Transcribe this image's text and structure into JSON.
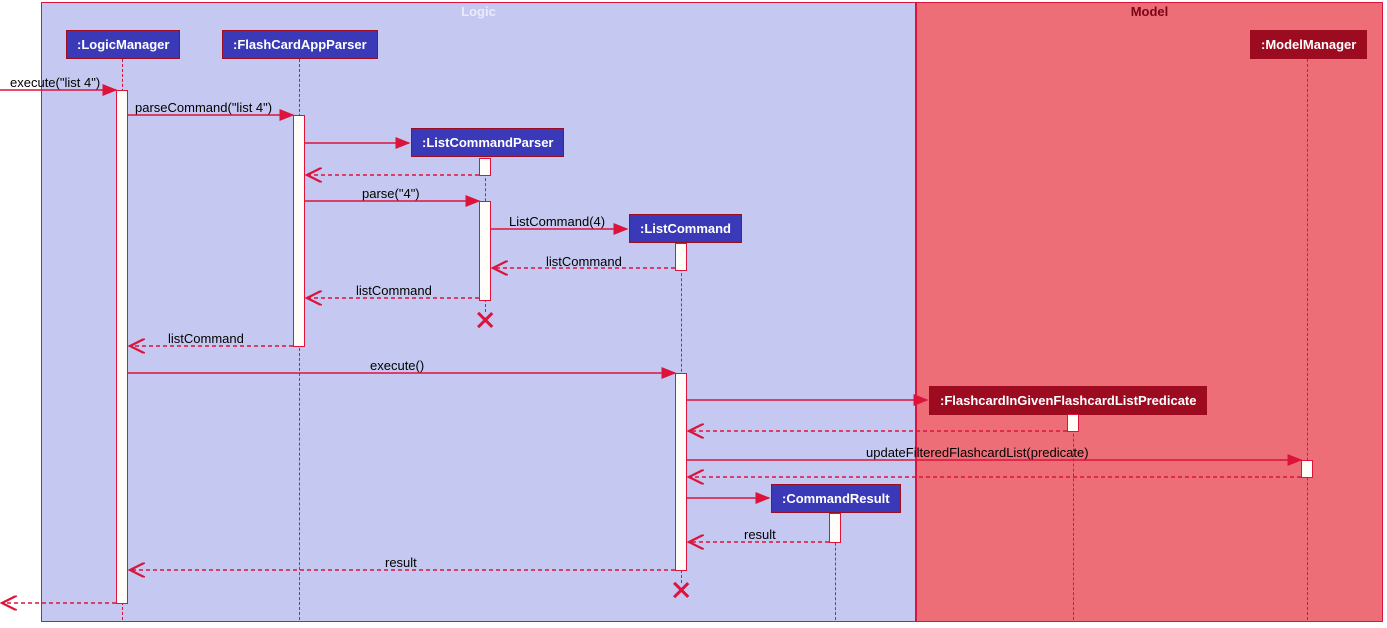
{
  "chart_data": {
    "type": "sequence-diagram",
    "frames": [
      {
        "name": "Logic",
        "participants": [
          ":LogicManager",
          ":FlashCardAppParser",
          ":ListCommandParser",
          ":ListCommand",
          ":CommandResult"
        ]
      },
      {
        "name": "Model",
        "participants": [
          ":ModelManager",
          ":FlashcardInGivenFlashcardListPredicate"
        ]
      }
    ],
    "messages": [
      {
        "from": "caller",
        "to": ":LogicManager",
        "label": "execute(\"list 4\")",
        "type": "sync"
      },
      {
        "from": ":LogicManager",
        "to": ":FlashCardAppParser",
        "label": "parseCommand(\"list 4\")",
        "type": "sync"
      },
      {
        "from": ":FlashCardAppParser",
        "to": ":ListCommandParser",
        "label": "",
        "type": "create"
      },
      {
        "from": ":ListCommandParser",
        "to": ":FlashCardAppParser",
        "label": "",
        "type": "return"
      },
      {
        "from": ":FlashCardAppParser",
        "to": ":ListCommandParser",
        "label": "parse(\"4\")",
        "type": "sync"
      },
      {
        "from": ":ListCommandParser",
        "to": ":ListCommand",
        "label": "ListCommand(4)",
        "type": "create"
      },
      {
        "from": ":ListCommand",
        "to": ":ListCommandParser",
        "label": "listCommand",
        "type": "return"
      },
      {
        "from": ":ListCommandParser",
        "to": ":FlashCardAppParser",
        "label": "listCommand",
        "type": "return"
      },
      {
        "from": ":ListCommandParser",
        "to": "destroy",
        "label": "",
        "type": "destroy"
      },
      {
        "from": ":FlashCardAppParser",
        "to": ":LogicManager",
        "label": "listCommand",
        "type": "return"
      },
      {
        "from": ":LogicManager",
        "to": ":ListCommand",
        "label": "execute()",
        "type": "sync"
      },
      {
        "from": ":ListCommand",
        "to": ":FlashcardInGivenFlashcardListPredicate",
        "label": "",
        "type": "create"
      },
      {
        "from": ":FlashcardInGivenFlashcardListPredicate",
        "to": ":ListCommand",
        "label": "",
        "type": "return"
      },
      {
        "from": ":ListCommand",
        "to": ":ModelManager",
        "label": "updateFilteredFlashcardList(predicate)",
        "type": "sync"
      },
      {
        "from": ":ModelManager",
        "to": ":ListCommand",
        "label": "",
        "type": "return"
      },
      {
        "from": ":ListCommand",
        "to": ":CommandResult",
        "label": "",
        "type": "create"
      },
      {
        "from": ":CommandResult",
        "to": ":ListCommand",
        "label": "result",
        "type": "return"
      },
      {
        "from": ":ListCommand",
        "to": ":LogicManager",
        "label": "result",
        "type": "return"
      },
      {
        "from": ":ListCommand",
        "to": "destroy",
        "label": "",
        "type": "destroy"
      },
      {
        "from": ":LogicManager",
        "to": "caller",
        "label": "",
        "type": "return"
      }
    ]
  },
  "frames": {
    "logic": "Logic",
    "model": "Model"
  },
  "participants": {
    "logicManager": ":LogicManager",
    "flashCardAppParser": ":FlashCardAppParser",
    "listCommandParser": ":ListCommandParser",
    "listCommand": ":ListCommand",
    "commandResult": ":CommandResult",
    "modelManager": ":ModelManager",
    "predicate": ":FlashcardInGivenFlashcardListPredicate"
  },
  "messages": {
    "m1": "execute(\"list 4\")",
    "m2": "parseCommand(\"list 4\")",
    "m5": "parse(\"4\")",
    "m6": "ListCommand(4)",
    "m7": "listCommand",
    "m8": "listCommand",
    "m10": "listCommand",
    "m11": "execute()",
    "m14": "updateFilteredFlashcardList(predicate)",
    "m17": "result",
    "m18": "result"
  }
}
